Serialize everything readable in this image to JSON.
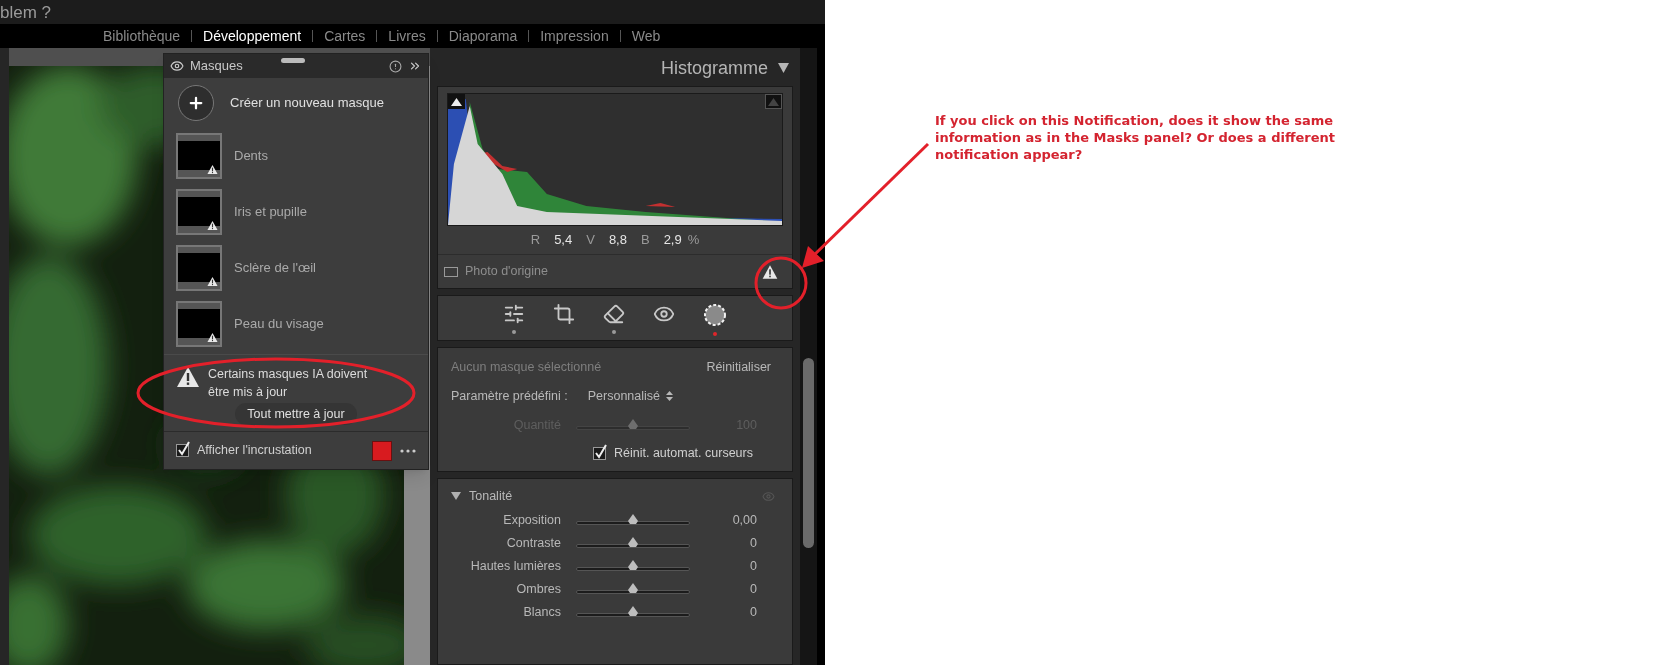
{
  "forum_heading": "blem ?",
  "top_nav": [
    {
      "label": "Bibliothèque",
      "selected": false
    },
    {
      "label": "Développement",
      "selected": true
    },
    {
      "label": "Cartes",
      "selected": false
    },
    {
      "label": "Livres",
      "selected": false
    },
    {
      "label": "Diaporama",
      "selected": false
    },
    {
      "label": "Impression",
      "selected": false
    },
    {
      "label": "Web",
      "selected": false
    }
  ],
  "masks_panel": {
    "title": "Masques",
    "create_label": "Créer un nouveau masque",
    "masks": [
      {
        "name": "Dents",
        "needs_update": true
      },
      {
        "name": "Iris et pupille",
        "needs_update": true
      },
      {
        "name": "Sclère de l'œil",
        "needs_update": true
      },
      {
        "name": "Peau du visage",
        "needs_update": true
      }
    ],
    "notification": {
      "message": "Certains masques IA doivent être mis à jour",
      "button": "Tout mettre à jour"
    },
    "overlay": {
      "label": "Afficher l'incrustation",
      "checked": true,
      "color": "#d81b1f"
    }
  },
  "histogram": {
    "title": "Histogramme",
    "stats": [
      {
        "channel": "R",
        "value": "5,4"
      },
      {
        "channel": "V",
        "value": "8,8"
      },
      {
        "channel": "B",
        "value": "2,9"
      }
    ],
    "unit": "%",
    "original_photo": {
      "label": "Photo d'origine",
      "checked": false
    },
    "warning": true
  },
  "tools": [
    {
      "kind": "edit",
      "selected": false,
      "edited": true
    },
    {
      "kind": "crop",
      "selected": false,
      "edited": false
    },
    {
      "kind": "heal",
      "selected": false,
      "edited": true
    },
    {
      "kind": "redeye",
      "selected": false,
      "edited": false
    },
    {
      "kind": "mask",
      "selected": true,
      "edited": false
    }
  ],
  "mask_settings": {
    "status": "Aucun masque sélectionné",
    "reset": "Réinitialiser",
    "preset_label": "Paramètre prédéfini :",
    "preset_value": "Personnalisé",
    "amount": {
      "label": "Quantité",
      "value": "100",
      "level": 0.5,
      "disabled": true
    },
    "auto_reset": {
      "label": "Réinit. automat. curseurs",
      "checked": true
    }
  },
  "tone": {
    "title": "Tonalité",
    "expanded": true,
    "sliders": [
      {
        "label": "Exposition",
        "value": "0,00",
        "level": 0.5
      },
      {
        "label": "Contraste",
        "value": "0",
        "level": 0.5
      },
      {
        "label": "Hautes lumières",
        "value": "0",
        "level": 0.5
      },
      {
        "label": "Ombres",
        "value": "0",
        "level": 0.5
      },
      {
        "label": "Blancs",
        "value": "0",
        "level": 0.5
      }
    ]
  },
  "annotation": {
    "text": "If you click on this Notification, does it show the same information as in the Masks panel? Or does a different notification appear?"
  }
}
